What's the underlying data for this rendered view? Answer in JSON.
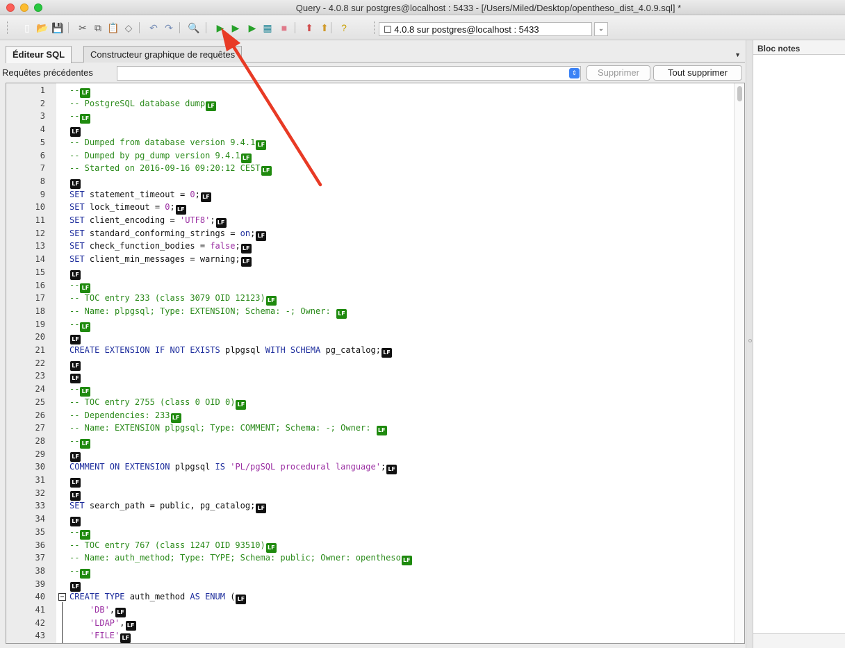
{
  "window": {
    "title": "Query - 4.0.8 sur postgres@localhost : 5433 - [/Users/Miled/Desktop/opentheso_dist_4.0.9.sql] *"
  },
  "toolbar": {
    "connection_value": "☐ 4.0.8 sur postgres@localhost : 5433",
    "buttons": [
      {
        "name": "new-file-icon",
        "glyph": "▯",
        "color": "#ffffff"
      },
      {
        "name": "open-folder-icon",
        "glyph": "📂",
        "color": "#d49a2a"
      },
      {
        "name": "save-icon",
        "glyph": "💾",
        "color": "#2a4b8d"
      },
      {
        "name": "cut-icon",
        "glyph": "✂",
        "color": "#555555"
      },
      {
        "name": "copy-icon",
        "glyph": "⧉",
        "color": "#555555"
      },
      {
        "name": "paste-icon",
        "glyph": "📋",
        "color": "#555555"
      },
      {
        "name": "clear-icon",
        "glyph": "◇",
        "color": "#777777"
      },
      {
        "name": "undo-icon",
        "glyph": "↶",
        "color": "#7a90b8"
      },
      {
        "name": "redo-icon",
        "glyph": "↷",
        "color": "#7a90b8"
      },
      {
        "name": "find-icon",
        "glyph": "🔍",
        "color": "#555555"
      },
      {
        "name": "execute-icon",
        "glyph": "▶",
        "color": "#27a12a"
      },
      {
        "name": "execute-pgscript-icon",
        "glyph": "▶",
        "color": "#27a12a"
      },
      {
        "name": "execute-to-file-icon",
        "glyph": "▶",
        "color": "#27a12a"
      },
      {
        "name": "explain-icon",
        "glyph": "▦",
        "color": "#2a8a9a"
      },
      {
        "name": "cancel-query-icon",
        "glyph": "■",
        "color": "#e07a8a"
      },
      {
        "name": "macros-icon",
        "glyph": "⬆",
        "color": "#d04a4a"
      },
      {
        "name": "favourites-icon",
        "glyph": "⬆",
        "color": "#d09a2a"
      },
      {
        "name": "help-icon",
        "glyph": "?",
        "color": "#c8a000"
      }
    ]
  },
  "tabs": [
    {
      "label": "Éditeur SQL"
    },
    {
      "label": "Constructeur graphique de requêtes"
    }
  ],
  "previous_queries": {
    "label": "Requêtes précédentes",
    "delete_label": "Supprimer",
    "delete_all_label": "Tout supprimer"
  },
  "notes": {
    "title": "Bloc notes"
  },
  "lf_label": "LF",
  "editor": {
    "lines": [
      {
        "n": "1",
        "parts": [
          {
            "t": "--",
            "c": "cm"
          }
        ],
        "lf": "g"
      },
      {
        "n": "2",
        "parts": [
          {
            "t": "-- PostgreSQL database dump",
            "c": "cm"
          }
        ],
        "lf": "g"
      },
      {
        "n": "3",
        "parts": [
          {
            "t": "--",
            "c": "cm"
          }
        ],
        "lf": "g"
      },
      {
        "n": "4",
        "parts": [],
        "lf": "b"
      },
      {
        "n": "5",
        "parts": [
          {
            "t": "-- Dumped from database version 9.4.1",
            "c": "cm"
          }
        ],
        "lf": "g"
      },
      {
        "n": "6",
        "parts": [
          {
            "t": "-- Dumped by pg_dump version 9.4.1",
            "c": "cm"
          }
        ],
        "lf": "g"
      },
      {
        "n": "7",
        "parts": [
          {
            "t": "-- Started on 2016-09-16 09:20:12 CEST",
            "c": "cm"
          }
        ],
        "lf": "g"
      },
      {
        "n": "8",
        "parts": [],
        "lf": "b"
      },
      {
        "n": "9",
        "parts": [
          {
            "t": "SET",
            "c": "kw"
          },
          {
            "t": " statement_timeout = ",
            "c": "pl"
          },
          {
            "t": "0",
            "c": "st"
          },
          {
            "t": ";",
            "c": "pl"
          }
        ],
        "lf": "b"
      },
      {
        "n": "10",
        "parts": [
          {
            "t": "SET",
            "c": "kw"
          },
          {
            "t": " lock_timeout = ",
            "c": "pl"
          },
          {
            "t": "0",
            "c": "st"
          },
          {
            "t": ";",
            "c": "pl"
          }
        ],
        "lf": "b"
      },
      {
        "n": "11",
        "parts": [
          {
            "t": "SET",
            "c": "kw"
          },
          {
            "t": " client_encoding = ",
            "c": "pl"
          },
          {
            "t": "'UTF8'",
            "c": "st"
          },
          {
            "t": ";",
            "c": "pl"
          }
        ],
        "lf": "b"
      },
      {
        "n": "12",
        "parts": [
          {
            "t": "SET",
            "c": "kw"
          },
          {
            "t": " standard_conforming_strings = ",
            "c": "pl"
          },
          {
            "t": "on",
            "c": "kw"
          },
          {
            "t": ";",
            "c": "pl"
          }
        ],
        "lf": "b"
      },
      {
        "n": "13",
        "parts": [
          {
            "t": "SET",
            "c": "kw"
          },
          {
            "t": " check_function_bodies = ",
            "c": "pl"
          },
          {
            "t": "false",
            "c": "st"
          },
          {
            "t": ";",
            "c": "pl"
          }
        ],
        "lf": "b"
      },
      {
        "n": "14",
        "parts": [
          {
            "t": "SET",
            "c": "kw"
          },
          {
            "t": " client_min_messages = warning;",
            "c": "pl"
          }
        ],
        "lf": "b"
      },
      {
        "n": "15",
        "parts": [],
        "lf": "b"
      },
      {
        "n": "16",
        "parts": [
          {
            "t": "--",
            "c": "cm"
          }
        ],
        "lf": "g"
      },
      {
        "n": "17",
        "parts": [
          {
            "t": "-- TOC entry 233 (class 3079 OID 12123)",
            "c": "cm"
          }
        ],
        "lf": "g"
      },
      {
        "n": "18",
        "parts": [
          {
            "t": "-- Name: plpgsql; Type: EXTENSION; Schema: -; Owner: ",
            "c": "cm"
          }
        ],
        "lf": "g"
      },
      {
        "n": "19",
        "parts": [
          {
            "t": "--",
            "c": "cm"
          }
        ],
        "lf": "g"
      },
      {
        "n": "20",
        "parts": [],
        "lf": "b"
      },
      {
        "n": "21",
        "parts": [
          {
            "t": "CREATE EXTENSION IF NOT EXISTS",
            "c": "kw"
          },
          {
            "t": " plpgsql ",
            "c": "pl"
          },
          {
            "t": "WITH SCHEMA",
            "c": "kw"
          },
          {
            "t": " pg_catalog;",
            "c": "pl"
          }
        ],
        "lf": "b"
      },
      {
        "n": "22",
        "parts": [],
        "lf": "b"
      },
      {
        "n": "23",
        "parts": [],
        "lf": "b"
      },
      {
        "n": "24",
        "parts": [
          {
            "t": "--",
            "c": "cm"
          }
        ],
        "lf": "g"
      },
      {
        "n": "25",
        "parts": [
          {
            "t": "-- TOC entry 2755 (class 0 OID 0)",
            "c": "cm"
          }
        ],
        "lf": "g"
      },
      {
        "n": "26",
        "parts": [
          {
            "t": "-- Dependencies: 233",
            "c": "cm"
          }
        ],
        "lf": "g"
      },
      {
        "n": "27",
        "parts": [
          {
            "t": "-- Name: EXTENSION plpgsql; Type: COMMENT; Schema: -; Owner: ",
            "c": "cm"
          }
        ],
        "lf": "g"
      },
      {
        "n": "28",
        "parts": [
          {
            "t": "--",
            "c": "cm"
          }
        ],
        "lf": "g"
      },
      {
        "n": "29",
        "parts": [],
        "lf": "b"
      },
      {
        "n": "30",
        "parts": [
          {
            "t": "COMMENT ON EXTENSION",
            "c": "kw"
          },
          {
            "t": " plpgsql ",
            "c": "pl"
          },
          {
            "t": "IS",
            "c": "kw"
          },
          {
            "t": " ",
            "c": "pl"
          },
          {
            "t": "'PL/pgSQL procedural language'",
            "c": "st"
          },
          {
            "t": ";",
            "c": "pl"
          }
        ],
        "lf": "b"
      },
      {
        "n": "31",
        "parts": [],
        "lf": "b"
      },
      {
        "n": "32",
        "parts": [],
        "lf": "b"
      },
      {
        "n": "33",
        "parts": [
          {
            "t": "SET",
            "c": "kw"
          },
          {
            "t": " search_path = public, pg_catalog;",
            "c": "pl"
          }
        ],
        "lf": "b"
      },
      {
        "n": "34",
        "parts": [],
        "lf": "b"
      },
      {
        "n": "35",
        "parts": [
          {
            "t": "--",
            "c": "cm"
          }
        ],
        "lf": "g"
      },
      {
        "n": "36",
        "parts": [
          {
            "t": "-- TOC entry 767 (class 1247 OID 93510)",
            "c": "cm"
          }
        ],
        "lf": "g"
      },
      {
        "n": "37",
        "parts": [
          {
            "t": "-- Name: auth_method; Type: TYPE; Schema: public; Owner: opentheso",
            "c": "cm"
          }
        ],
        "lf": "g"
      },
      {
        "n": "38",
        "parts": [
          {
            "t": "--",
            "c": "cm"
          }
        ],
        "lf": "g"
      },
      {
        "n": "39",
        "parts": [],
        "lf": "b"
      },
      {
        "n": "40",
        "parts": [
          {
            "t": "CREATE TYPE",
            "c": "kw"
          },
          {
            "t": " auth_method ",
            "c": "pl"
          },
          {
            "t": "AS ENUM",
            "c": "kw"
          },
          {
            "t": " (",
            "c": "pl"
          }
        ],
        "lf": "b",
        "fold": true
      },
      {
        "n": "41",
        "parts": [
          {
            "t": "    ",
            "c": "pl"
          },
          {
            "t": "'DB'",
            "c": "st"
          },
          {
            "t": ",",
            "c": "pl"
          }
        ],
        "lf": "b"
      },
      {
        "n": "42",
        "parts": [
          {
            "t": "    ",
            "c": "pl"
          },
          {
            "t": "'LDAP'",
            "c": "st"
          },
          {
            "t": ",",
            "c": "pl"
          }
        ],
        "lf": "b"
      },
      {
        "n": "43",
        "parts": [
          {
            "t": "    ",
            "c": "pl"
          },
          {
            "t": "'FILE'",
            "c": "st"
          }
        ],
        "lf": "b"
      }
    ]
  }
}
